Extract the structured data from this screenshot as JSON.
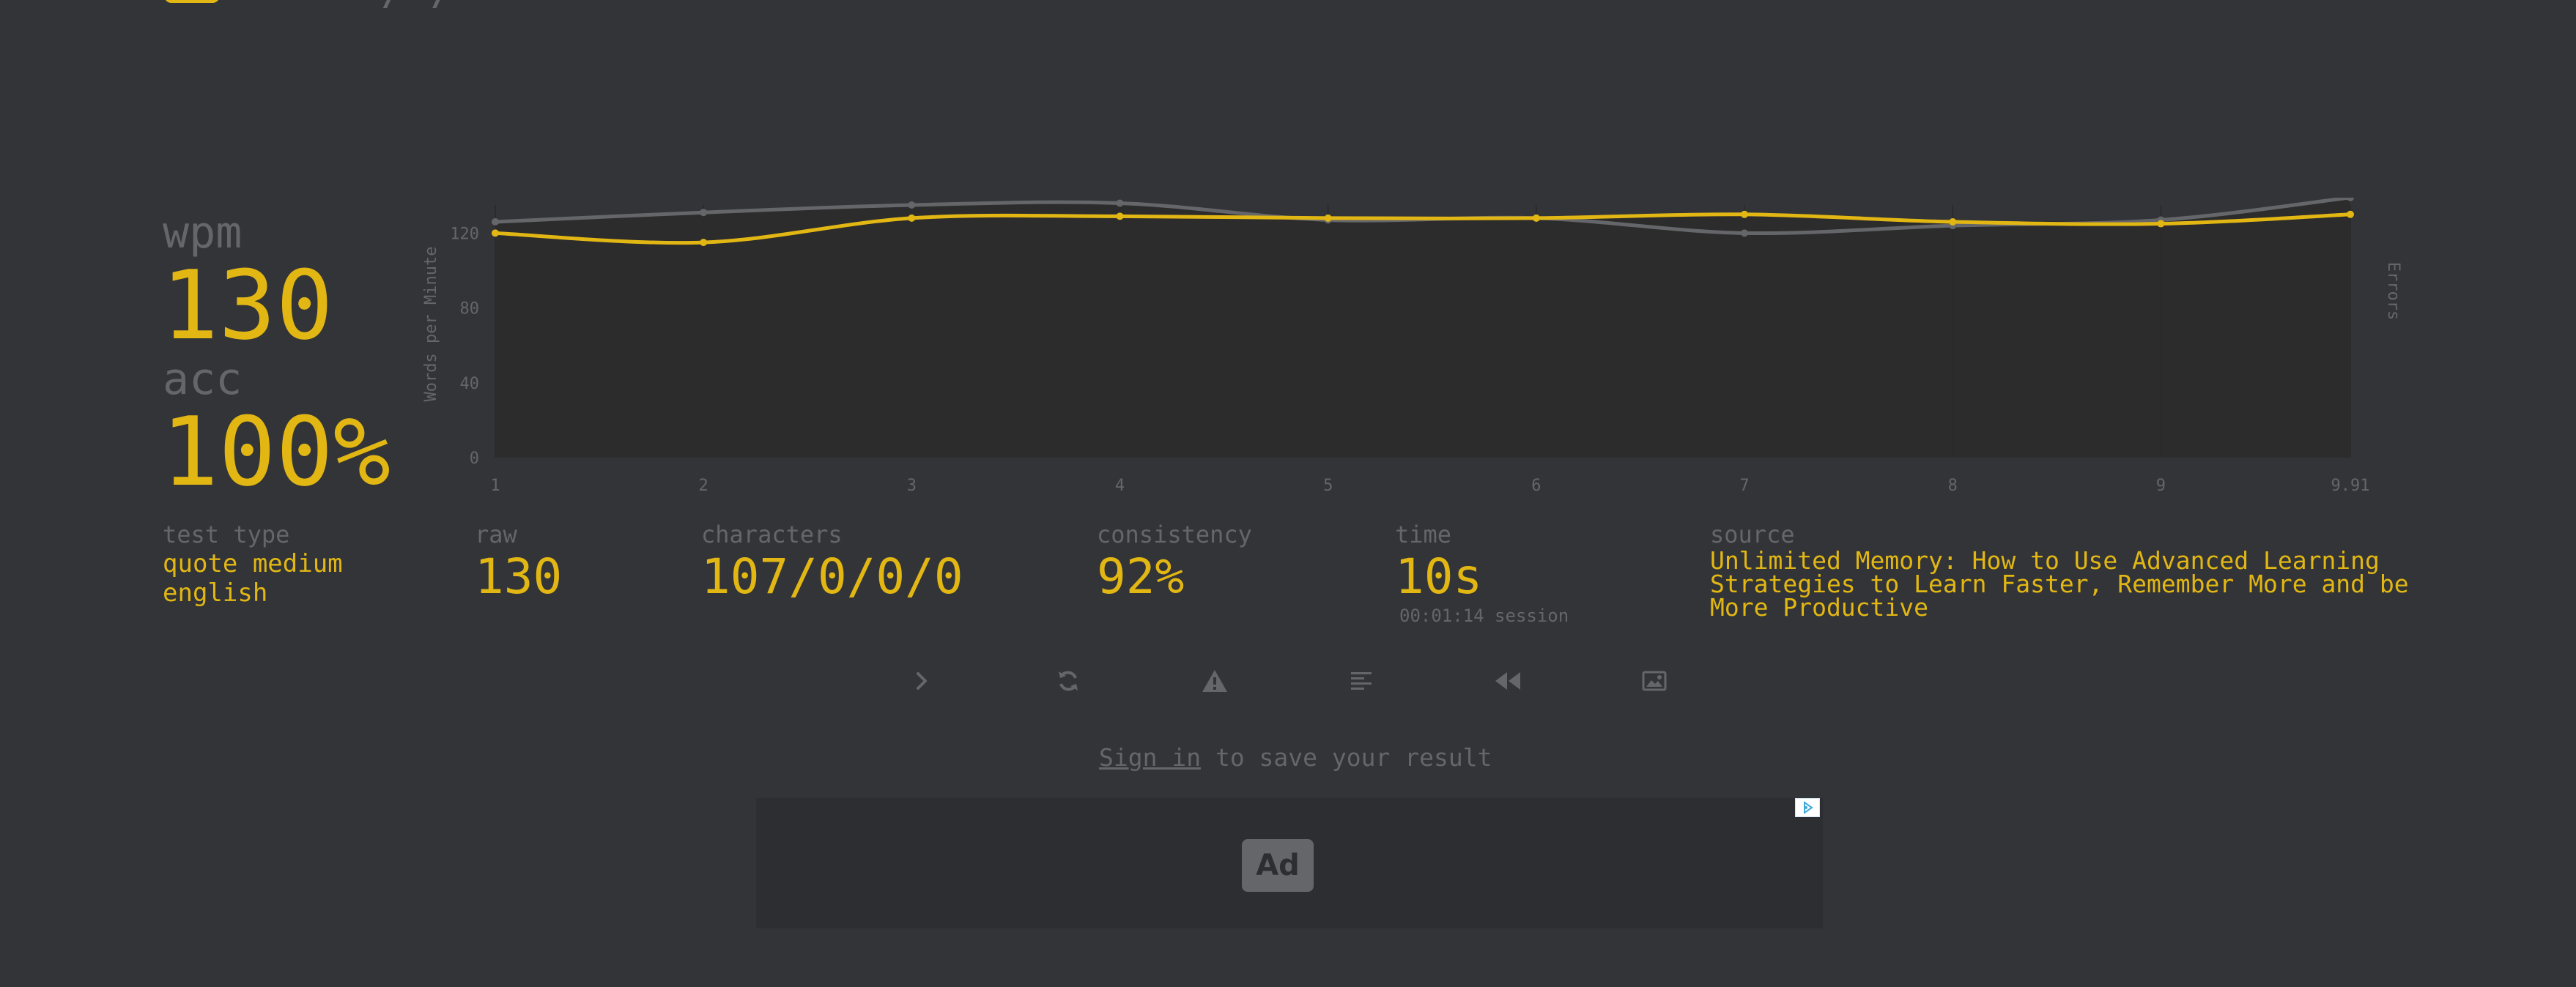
{
  "result": {
    "wpm_label": "wpm",
    "wpm_value": "130",
    "acc_label": "acc",
    "acc_value": "100%"
  },
  "stats": {
    "test_type_label": "test type",
    "test_type_line1": "quote medium",
    "test_type_line2": "english",
    "raw_label": "raw",
    "raw_value": "130",
    "characters_label": "characters",
    "characters_value": "107/0/0/0",
    "consistency_label": "consistency",
    "consistency_value": "92%",
    "time_label": "time",
    "time_value": "10s",
    "time_session": "00:01:14 session",
    "source_label": "source",
    "source_value": "Unlimited Memory: How to Use Advanced Learning Strategies to Learn Faster, Remember More and be More Productive"
  },
  "actions": [
    {
      "name": "next-test-button",
      "icon": "chevron-right-icon"
    },
    {
      "name": "restart-test-button",
      "icon": "refresh-icon"
    },
    {
      "name": "practice-words-button",
      "icon": "warning-icon"
    },
    {
      "name": "show-words-history-button",
      "icon": "align-left-icon"
    },
    {
      "name": "watch-replay-button",
      "icon": "rewind-icon"
    },
    {
      "name": "save-screenshot-button",
      "icon": "image-icon"
    }
  ],
  "signin": {
    "link": "Sign in",
    "rest": " to save your result"
  },
  "ad": {
    "badge": "Ad"
  },
  "colors": {
    "background": "#323437",
    "accent": "#e2b714",
    "muted": "#646669",
    "chart_bg": "#2c2c2c"
  },
  "chart_data": {
    "type": "line",
    "x": [
      1,
      2,
      3,
      4,
      5,
      6,
      7,
      8,
      9,
      9.91
    ],
    "x_tick_labels": [
      "1",
      "2",
      "3",
      "4",
      "5",
      "6",
      "7",
      "8",
      "9",
      "9.91"
    ],
    "ylabel": "Words per Minute",
    "y2label": "Errors",
    "ylim": [
      0,
      135
    ],
    "y_ticks": [
      0,
      40,
      80,
      120
    ],
    "series": [
      {
        "color": "#646669",
        "values": [
          126,
          131,
          135,
          136,
          127,
          128,
          120,
          124,
          127,
          139
        ]
      },
      {
        "color": "#e2b714",
        "values": [
          120,
          115,
          128,
          129,
          128,
          128,
          130,
          126,
          125,
          130
        ]
      }
    ],
    "grid": true
  }
}
